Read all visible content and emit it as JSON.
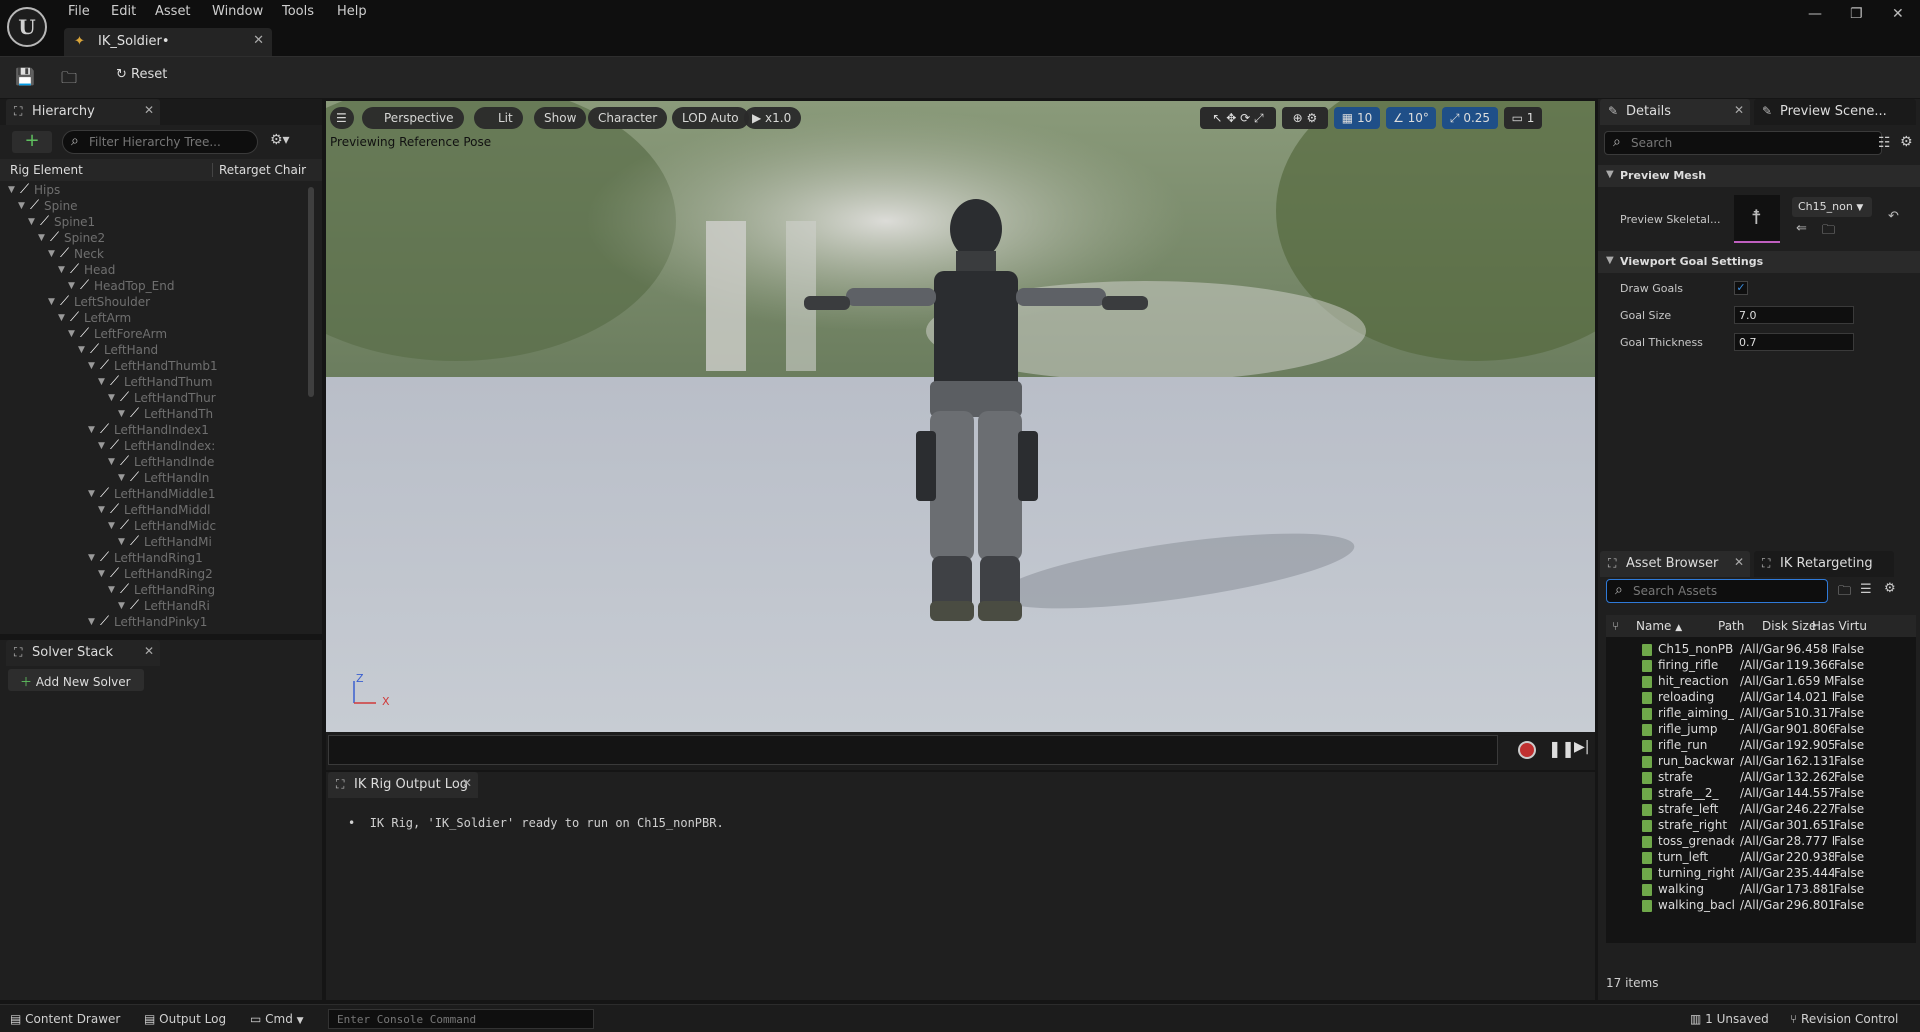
{
  "menu": [
    "File",
    "Edit",
    "Asset",
    "Window",
    "Tools",
    "Help"
  ],
  "doc_tab": {
    "label": "IK_Soldier•"
  },
  "toolbar": {
    "reset_label": "Reset"
  },
  "hierarchy": {
    "tab_label": "Hierarchy",
    "filter_placeholder": "Filter Hierarchy Tree...",
    "col_rig_element": "Rig Element",
    "col_retarget_chain": "Retarget Chair",
    "rows": [
      {
        "name": "Hips",
        "depth": 0
      },
      {
        "name": "Spine",
        "depth": 1
      },
      {
        "name": "Spine1",
        "depth": 2
      },
      {
        "name": "Spine2",
        "depth": 3
      },
      {
        "name": "Neck",
        "depth": 4
      },
      {
        "name": "Head",
        "depth": 5
      },
      {
        "name": "HeadTop_End",
        "depth": 6
      },
      {
        "name": "LeftShoulder",
        "depth": 4
      },
      {
        "name": "LeftArm",
        "depth": 5
      },
      {
        "name": "LeftForeArm",
        "depth": 6
      },
      {
        "name": "LeftHand",
        "depth": 7
      },
      {
        "name": "LeftHandThumb1",
        "depth": 8
      },
      {
        "name": "LeftHandThum",
        "depth": 9
      },
      {
        "name": "LeftHandThur",
        "depth": 10
      },
      {
        "name": "LeftHandTh",
        "depth": 11
      },
      {
        "name": "LeftHandIndex1",
        "depth": 8
      },
      {
        "name": "LeftHandIndex:",
        "depth": 9
      },
      {
        "name": "LeftHandInde",
        "depth": 10
      },
      {
        "name": "LeftHandIn",
        "depth": 11
      },
      {
        "name": "LeftHandMiddle1",
        "depth": 8
      },
      {
        "name": "LeftHandMiddl",
        "depth": 9
      },
      {
        "name": "LeftHandMidc",
        "depth": 10
      },
      {
        "name": "LeftHandMi",
        "depth": 11
      },
      {
        "name": "LeftHandRing1",
        "depth": 8
      },
      {
        "name": "LeftHandRing2",
        "depth": 9
      },
      {
        "name": "LeftHandRing",
        "depth": 10
      },
      {
        "name": "LeftHandRi",
        "depth": 11
      },
      {
        "name": "LeftHandPinky1",
        "depth": 8
      }
    ]
  },
  "solver_stack": {
    "tab_label": "Solver Stack",
    "add_label": "Add New Solver"
  },
  "viewport": {
    "menu_icon": "hamburger-icon",
    "perspective": "Perspective",
    "lit": "Lit",
    "show": "Show",
    "character": "Character",
    "lod": "LOD Auto",
    "play_speed": "x1.0",
    "grid_snap": "10",
    "rot_snap": "10°",
    "scale_snap": "0.25",
    "camera_speed": "1",
    "overlay_text": "Previewing Reference Pose",
    "axis_z": "Z",
    "axis_x": "X"
  },
  "output_log": {
    "tab_label": "IK Rig Output Log",
    "message": "IK Rig, 'IK_Soldier' ready to run on Ch15_nonPBR."
  },
  "details": {
    "tab_label": "Details",
    "preview_tab_label": "Preview Scene...",
    "search_placeholder": "Search",
    "preview_mesh_header": "Preview Mesh",
    "preview_skeletal_label": "Preview Skeletal...",
    "preview_mesh_value": "Ch15_non",
    "goal_settings_header": "Viewport Goal Settings",
    "draw_goals_label": "Draw Goals",
    "goal_size_label": "Goal Size",
    "goal_size_value": "7.0",
    "goal_thickness_label": "Goal Thickness",
    "goal_thickness_value": "0.7"
  },
  "asset_browser": {
    "tab_label": "Asset Browser",
    "retarget_tab_label": "IK Retargeting",
    "search_placeholder": "Search Assets",
    "columns": [
      "Name",
      "Path",
      "Disk Size",
      "Has Virtu"
    ],
    "rows": [
      [
        "Ch15_nonPBF",
        "/All/Gar",
        "96.458 Ki",
        "False"
      ],
      [
        "firing_rifle",
        "/All/Gar",
        "119.366 I",
        "False"
      ],
      [
        "hit_reaction",
        "/All/Gar",
        "1.659 Mil",
        "False"
      ],
      [
        "reloading",
        "/All/Gar",
        "14.021 M",
        "False"
      ],
      [
        "rifle_aiming_i",
        "/All/Gar",
        "510.317 I",
        "False"
      ],
      [
        "rifle_jump",
        "/All/Gar",
        "901.806 I",
        "False"
      ],
      [
        "rifle_run",
        "/All/Gar",
        "192.905 I",
        "False"
      ],
      [
        "run_backwar",
        "/All/Gar",
        "162.131 I",
        "False"
      ],
      [
        "strafe",
        "/All/Gar",
        "132.262 I",
        "False"
      ],
      [
        "strafe__2_",
        "/All/Gar",
        "144.557 I",
        "False"
      ],
      [
        "strafe_left",
        "/All/Gar",
        "246.227 I",
        "False"
      ],
      [
        "strafe_right",
        "/All/Gar",
        "301.651 I",
        "False"
      ],
      [
        "toss_grenade",
        "/All/Gar",
        "28.777 M",
        "False"
      ],
      [
        "turn_left",
        "/All/Gar",
        "220.938 I",
        "False"
      ],
      [
        "turning_right_",
        "/All/Gar",
        "235.444 I",
        "False"
      ],
      [
        "walking",
        "/All/Gar",
        "173.881 I",
        "False"
      ],
      [
        "walking_back",
        "/All/Gar",
        "296.801 I",
        "False"
      ]
    ],
    "item_count": "17 items"
  },
  "statusbar": {
    "content_drawer": "Content Drawer",
    "output_log": "Output Log",
    "cmd": "Cmd",
    "console_placeholder": "Enter Console Command",
    "unsaved": "1 Unsaved",
    "revision_control": "Revision Control"
  },
  "colors": {
    "accent_blue": "#1f6fd0",
    "asset_icon_green": "#6fa84a",
    "tab_bg": "#242424"
  }
}
